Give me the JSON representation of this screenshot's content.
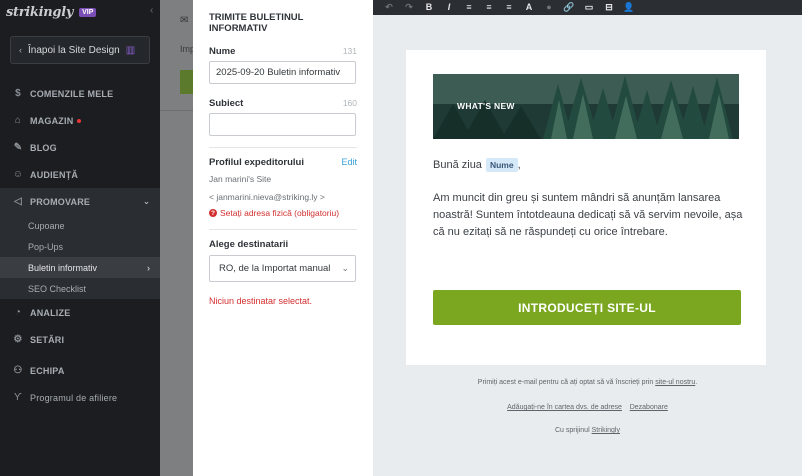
{
  "sidebar": {
    "logo": "strikingly",
    "vip": "VIP",
    "collapse": "‹",
    "back_button": "Înapoi la Site Design",
    "items": [
      {
        "label": "COMENZILE MELE",
        "icon": "dollar-icon"
      },
      {
        "label": "MAGAZIN",
        "icon": "store-icon"
      },
      {
        "label": "BLOG",
        "icon": "pen-icon"
      },
      {
        "label": "AUDIENȚĂ",
        "icon": "users-icon"
      },
      {
        "label": "PROMOVARE",
        "icon": "megaphone-icon"
      },
      {
        "label": "ANALIZE",
        "icon": "chart-icon"
      },
      {
        "label": "SETĂRI",
        "icon": "gear-icon"
      },
      {
        "label": "ECHIPA",
        "icon": "team-icon"
      },
      {
        "label": "Programul de afiliere",
        "icon": "affiliate-icon"
      }
    ],
    "sub_items": [
      "Cupoane",
      "Pop-Ups",
      "Buletin informativ",
      "SEO Checklist"
    ]
  },
  "behind": {
    "imp": "Imp"
  },
  "form": {
    "title": "TRIMITE BULETINUL INFORMATIV",
    "name_label": "Nume",
    "name_counter": "131",
    "name_value": "2025-09-20 Buletin informativ",
    "subject_label": "Subiect",
    "subject_counter": "160",
    "subject_value": "",
    "sender_label": "Profilul expeditorului",
    "edit_label": "Edit",
    "sender_name": "Jan marini's Site",
    "sender_email": "< janmarini.nieva@striking.ly >",
    "warning": "Setați adresa fizică (obligatoriu)",
    "recipients_label": "Alege destinatarii",
    "recipients_value": "RO, de la Importat manual",
    "error": "Niciun destinatar selectat."
  },
  "toolbar": [
    "↶",
    "↷",
    "B",
    "I",
    "≡",
    "≡",
    "≡",
    "A",
    "●",
    "🔗",
    "▭",
    "⊟",
    "👤"
  ],
  "email": {
    "banner_text": "WHAT'S NEW",
    "greeting": "Bună ziua",
    "name_tag": "Nume",
    "greeting_end": ",",
    "body": "Am muncit din greu și suntem mândri să anunțăm lansarea noastră! Suntem întotdeauna dedicați să vă servim nevoile, așa că nu ezitați să ne răspundeți cu orice întrebare.",
    "cta": "INTRODUCEȚI SITE-UL",
    "footer_line1_pre": "Primiți acest e-mail pentru că ați optat să vă înscrieți prin ",
    "footer_line1_link": "site-ul nostru",
    "footer_line1_post": ".",
    "footer_add": "Adăugați-ne în cartea dvs. de adrese",
    "footer_unsub": "Dezabonare",
    "footer_support_pre": "Cu sprijinul ",
    "footer_support_link": "Strikingly"
  },
  "colors": {
    "sidebar_bg": "#1b1d20",
    "accent_green": "#7ba720",
    "error_red": "#d32f2f",
    "link_blue": "#3aa0d8",
    "vip_purple": "#7a4fb5"
  }
}
